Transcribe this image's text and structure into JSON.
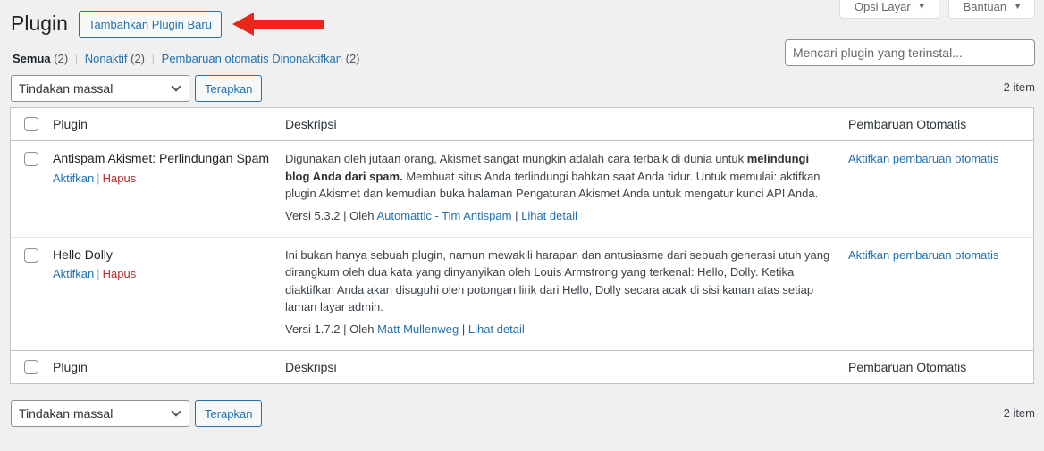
{
  "screen_meta": {
    "screen_options": "Opsi Layar",
    "help": "Bantuan",
    "dropdown_glyph": "▼"
  },
  "header": {
    "title": "Plugin",
    "add_new_label": "Tambahkan Plugin Baru",
    "annotation_arrow_color": "#e8261b"
  },
  "filters": [
    {
      "label": "Semua",
      "count": "(2)",
      "current": true
    },
    {
      "label": "Nonaktif",
      "count": "(2)",
      "current": false
    },
    {
      "label": "Pembaruan otomatis Dinonaktifkan",
      "count": "(2)",
      "current": false
    }
  ],
  "filter_separator": "|",
  "search": {
    "placeholder": "Mencari plugin yang terinstal...",
    "value": ""
  },
  "tablenav": {
    "bulk_action_selected": "Tindakan massal",
    "apply_label": "Terapkan",
    "item_count": "2 item"
  },
  "table": {
    "columns": {
      "name": "Plugin",
      "description": "Deskripsi",
      "auto_updates": "Pembaruan Otomatis"
    },
    "plugins": [
      {
        "name": "Antispam Akismet: Perlindungan Spam",
        "actions": {
          "activate": "Aktifkan",
          "delete": "Hapus"
        },
        "description_pre": "Digunakan oleh jutaan orang, Akismet sangat mungkin adalah cara terbaik di dunia untuk ",
        "description_bold": "melindungi blog Anda dari spam.",
        "description_post": " Membuat situs Anda terlindungi bahkan saat Anda tidur. Untuk memulai: aktifkan plugin Akismet dan kemudian buka halaman Pengaturan Akismet Anda untuk mengatur kunci API Anda.",
        "version_text": "Versi 5.3.2",
        "by_label": "Oleh",
        "author": "Automattic - Tim Antispam",
        "details_link": "Lihat detail",
        "auto_update_link": "Aktifkan pembaruan otomatis"
      },
      {
        "name": "Hello Dolly",
        "actions": {
          "activate": "Aktifkan",
          "delete": "Hapus"
        },
        "description_pre": "Ini bukan hanya sebuah plugin, namun mewakili harapan dan antusiasme dari sebuah generasi utuh yang dirangkum oleh dua kata yang dinyanyikan oleh Louis Armstrong yang terkenal: Hello, Dolly. Ketika diaktifkan Anda akan disuguhi oleh potongan lirik dari Hello, Dolly secara acak di sisi kanan atas setiap laman layar admin.",
        "description_bold": "",
        "description_post": "",
        "version_text": "Versi 1.7.2",
        "by_label": "Oleh",
        "author": "Matt Mullenweg",
        "details_link": "Lihat detail",
        "auto_update_link": "Aktifkan pembaruan otomatis"
      }
    ]
  },
  "separator": "|"
}
